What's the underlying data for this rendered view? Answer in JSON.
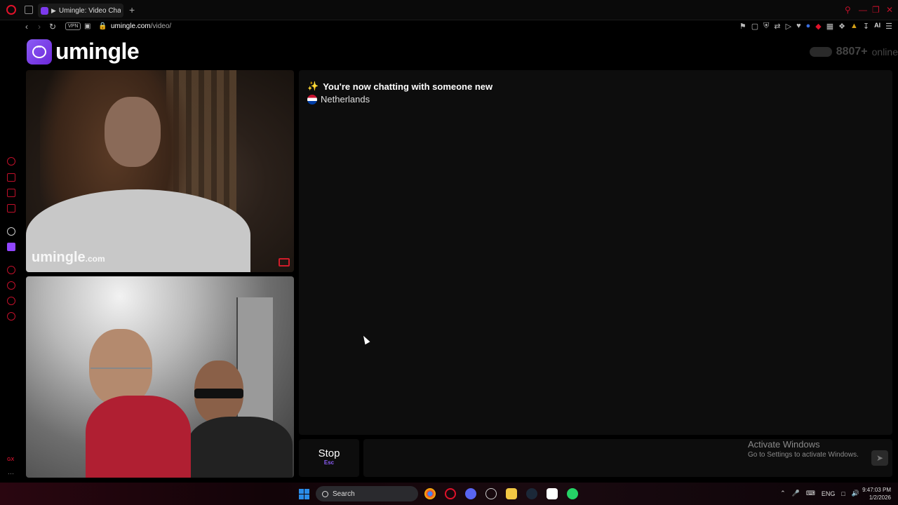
{
  "browser": {
    "tab_title": "Umingle: Video Chat w",
    "vpn_label": "VPN",
    "url_host": "umingle.com",
    "url_path": "/video/",
    "ai_label": "AI"
  },
  "header": {
    "brand": "umingle",
    "online_count": "8807+",
    "online_label": "online"
  },
  "stranger_video": {
    "watermark_main": "umingle",
    "watermark_suffix": ".com"
  },
  "chat": {
    "status_message": "You're now chatting with someone new",
    "country": "Netherlands"
  },
  "controls": {
    "stop_label": "Stop",
    "stop_shortcut": "Esc"
  },
  "windows_watermark": {
    "title": "Activate Windows",
    "subtitle": "Go to Settings to activate Windows."
  },
  "taskbar": {
    "search_label": "Search",
    "language": "ENG",
    "time": "9:47:03 PM",
    "date": "1/2/2026"
  },
  "colors": {
    "brand_purple": "#7c3aed",
    "opera_red": "#e0122a",
    "chat_bg": "#0d0d0d"
  }
}
